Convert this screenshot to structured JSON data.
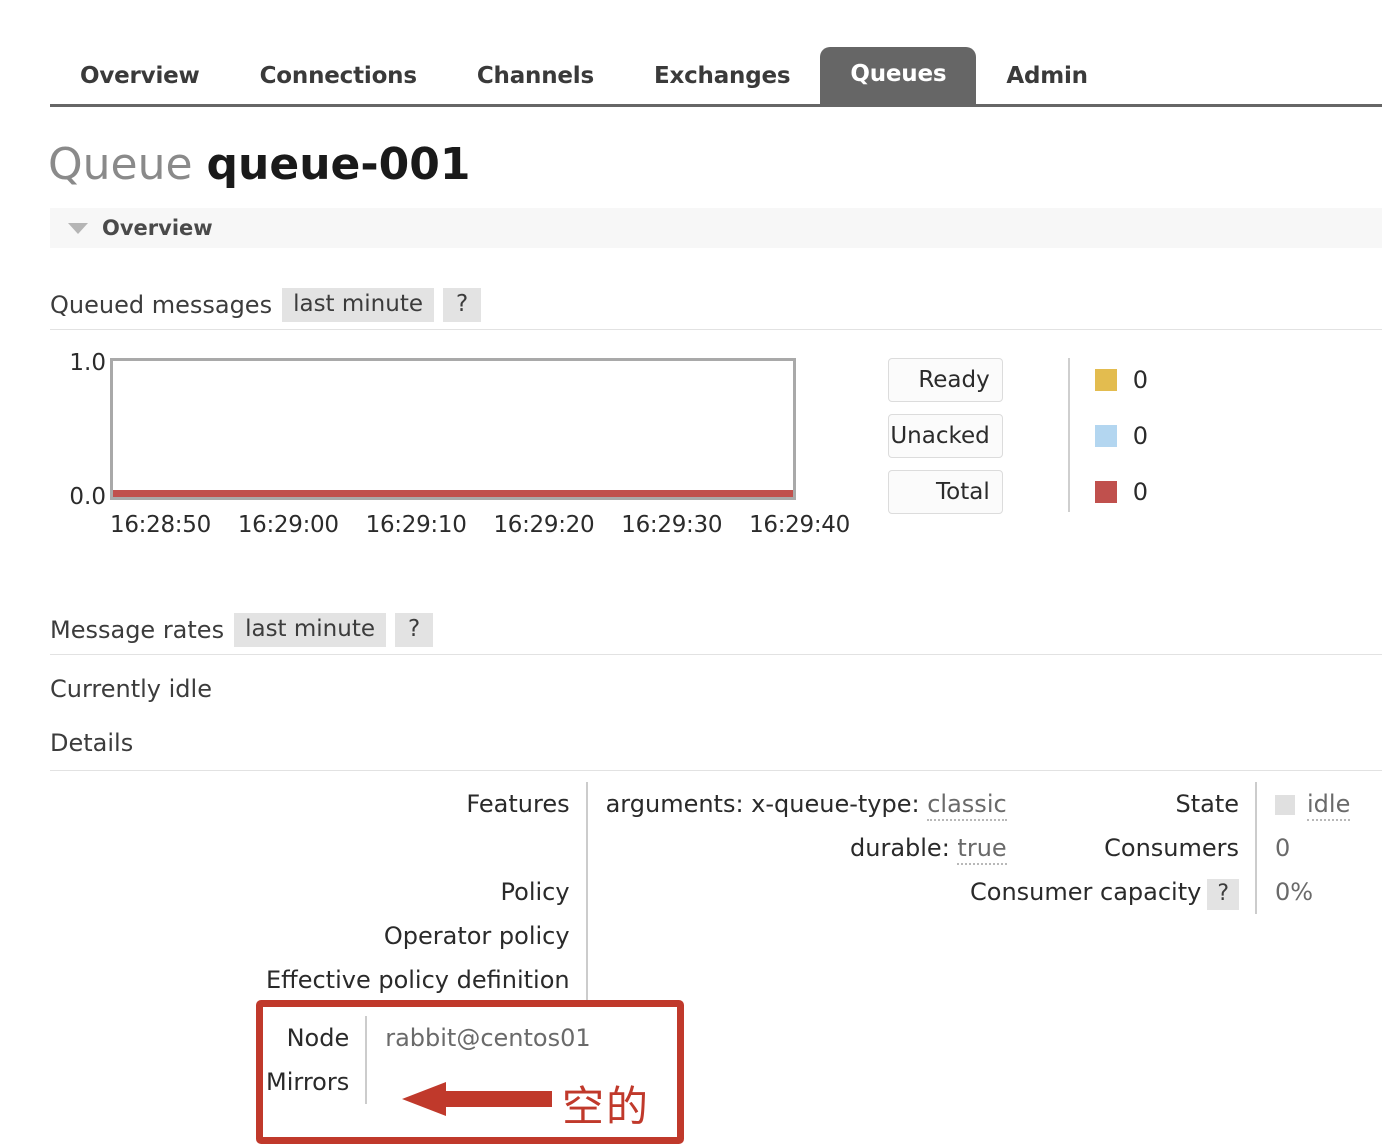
{
  "nav": {
    "tabs": [
      {
        "label": "Overview",
        "active": false
      },
      {
        "label": "Connections",
        "active": false
      },
      {
        "label": "Channels",
        "active": false
      },
      {
        "label": "Exchanges",
        "active": false
      },
      {
        "label": "Queues",
        "active": true
      },
      {
        "label": "Admin",
        "active": false
      }
    ]
  },
  "title": {
    "prefix": "Queue",
    "name": "queue-001"
  },
  "overview_section": {
    "label": "Overview",
    "caret": "chevron-down-icon"
  },
  "queued_messages": {
    "title": "Queued messages",
    "period": "last minute",
    "help": "?"
  },
  "chart_data": {
    "type": "line",
    "title": "Queued messages",
    "xlabel": "",
    "ylabel": "",
    "ylim": [
      0.0,
      1.0
    ],
    "ytick_labels": [
      "1.0",
      "0.0"
    ],
    "yticks": [
      1.0,
      0.0
    ],
    "x": [
      "16:28:50",
      "16:29:00",
      "16:29:10",
      "16:29:20",
      "16:29:30",
      "16:29:40"
    ],
    "grid": false,
    "legend_position": "right",
    "series": [
      {
        "name": "Ready",
        "color": "#e3bc4f",
        "values": [
          0,
          0,
          0,
          0,
          0,
          0
        ],
        "current": "0"
      },
      {
        "name": "Unacked",
        "color": "#b3d6f0",
        "values": [
          0,
          0,
          0,
          0,
          0,
          0
        ],
        "current": "0"
      },
      {
        "name": "Total",
        "color": "#c0504d",
        "values": [
          0,
          0,
          0,
          0,
          0,
          0
        ],
        "current": "0"
      }
    ]
  },
  "message_rates": {
    "title": "Message rates",
    "period": "last minute",
    "help": "?",
    "status": "Currently idle"
  },
  "details": {
    "heading": "Details",
    "left": {
      "labels": [
        "Features",
        "",
        "Policy",
        "Operator policy",
        "Effective policy definition"
      ],
      "rows": [
        {
          "label": "Features",
          "value": "arguments: x-queue-type:",
          "extra": "classic"
        },
        {
          "label": "",
          "value": "durable:",
          "extra": "true"
        },
        {
          "label": "Policy",
          "value": "",
          "extra": ""
        },
        {
          "label": "Operator policy",
          "value": "",
          "extra": ""
        },
        {
          "label": "Effective policy definition",
          "value": "",
          "extra": ""
        }
      ]
    },
    "right": {
      "rows": [
        {
          "label": "State",
          "value": "idle",
          "swatch": "#e0e0e0",
          "help": ""
        },
        {
          "label": "Consumers",
          "value": "0",
          "help": ""
        },
        {
          "label": "Consumer capacity",
          "value": "0%",
          "help": "?"
        }
      ]
    },
    "bottom": {
      "rows": [
        {
          "label": "Node",
          "value": "rabbit@centos01"
        },
        {
          "label": "Mirrors",
          "value": ""
        }
      ]
    }
  },
  "annotation": {
    "text": "空的",
    "color": "#c0392b",
    "arrow": "left-arrow-icon"
  }
}
